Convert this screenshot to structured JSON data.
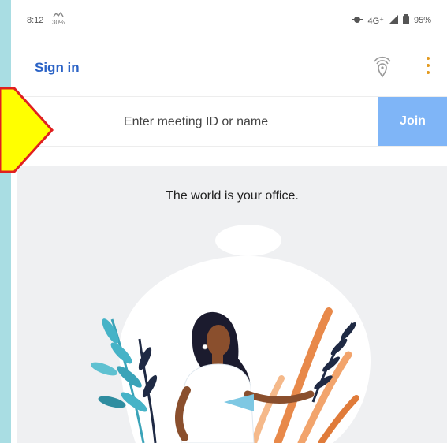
{
  "status_bar": {
    "time": "8:12",
    "notification": "30%",
    "network": "4G⁺",
    "battery": "95%"
  },
  "app_bar": {
    "sign_in_label": "Sign in",
    "share_icon": "proximity-share-icon",
    "menu_icon": "more-vertical-icon"
  },
  "join": {
    "placeholder": "Enter meeting ID or name",
    "value": "",
    "button_label": "Join"
  },
  "hero": {
    "tagline": "The world is your office."
  },
  "colors": {
    "accent": "#2b63c6",
    "join_button": "#7fb5f7",
    "menu_dots": "#e39a1f",
    "card_bg": "#eff0f2",
    "annotation_arrow": "#ffff00"
  }
}
